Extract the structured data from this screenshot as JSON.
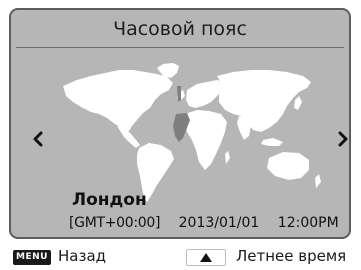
{
  "header": {
    "title": "Часовой пояс"
  },
  "timezone": {
    "city": "Лондон",
    "gmt": "[GMT+00:00]",
    "date": "2013/01/01",
    "time": "12:00PM"
  },
  "footer": {
    "menu_key": "MENU",
    "back_label": "Назад",
    "dst_label": "Летнее время"
  },
  "icons": {
    "left": "chevron-left-icon",
    "right": "chevron-right-icon",
    "up": "up-triangle-icon"
  },
  "colors": {
    "panel": "#b6b6b6",
    "land": "#ffffff",
    "selected_zone": "#7f7f7f"
  }
}
